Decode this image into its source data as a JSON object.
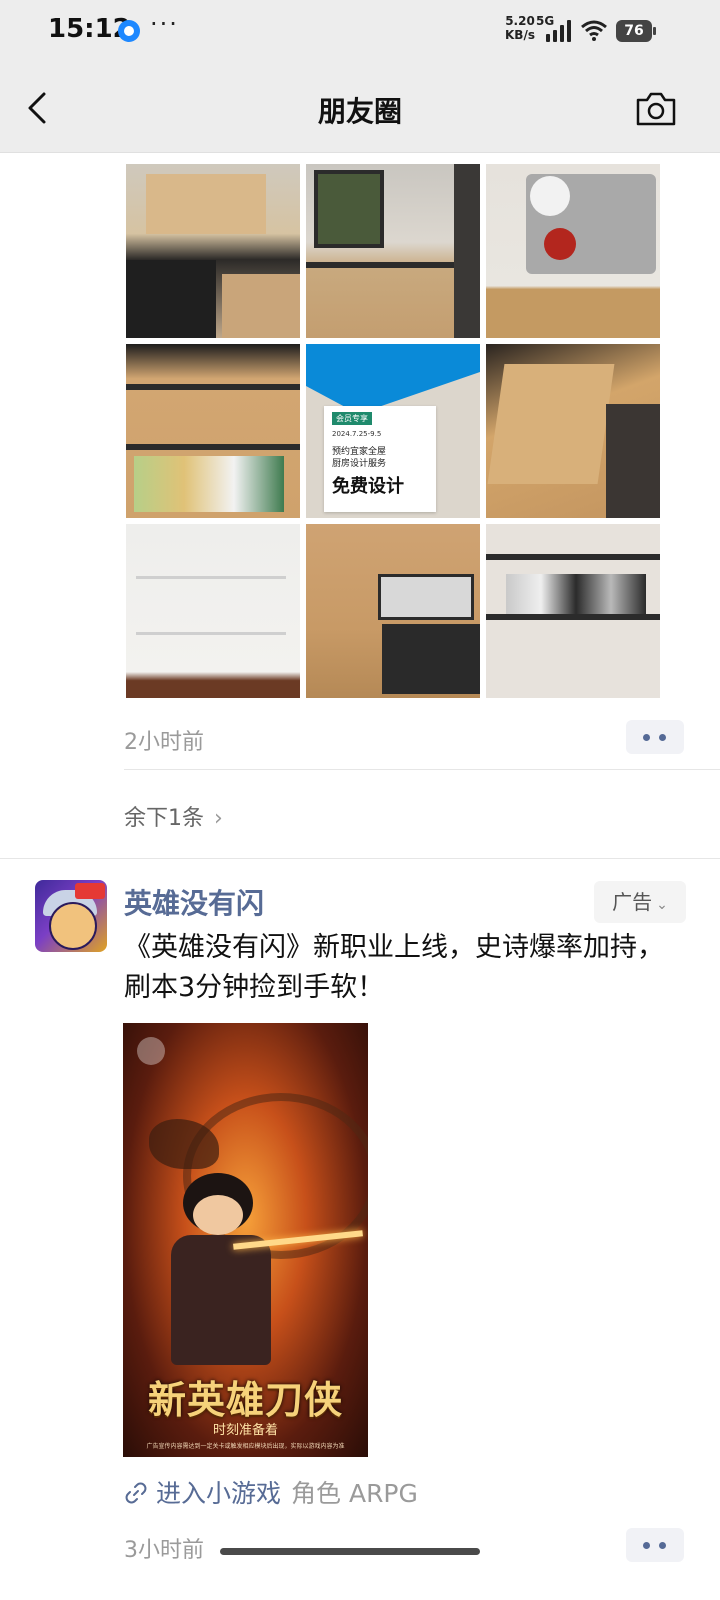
{
  "status_bar": {
    "time": "15:12",
    "net_speed_value": "5.20",
    "net_speed_unit": "KB/s",
    "network": "5G",
    "battery": "76"
  },
  "header": {
    "title": "朋友圈"
  },
  "post1": {
    "time_ago": "2小时前",
    "remaining": "余下1条",
    "promo_image": {
      "tag": "会员专享",
      "date": "2024.7.25-9.5",
      "line1": "预约宜家全屋",
      "line2": "厨房设计服务",
      "headline": "免费设计"
    }
  },
  "ad_post": {
    "poster_name": "英雄没有闪",
    "ad_label": "广告",
    "text": "《英雄没有闪》新职业上线，史诗爆率加持，刷本3分钟捡到手软！",
    "image": {
      "headline": "新英雄刀侠",
      "subline": "时刻准备着",
      "disclaimer": "广告宣传内容需达到一定关卡或触发相应模块后出现，实际以游戏内容为准"
    },
    "mini_game_label": "进入小游戏",
    "category": "角色 ARPG",
    "time_ago": "3小时前"
  },
  "colors": {
    "link_blue": "#576b95",
    "header_bg": "#ededed"
  }
}
